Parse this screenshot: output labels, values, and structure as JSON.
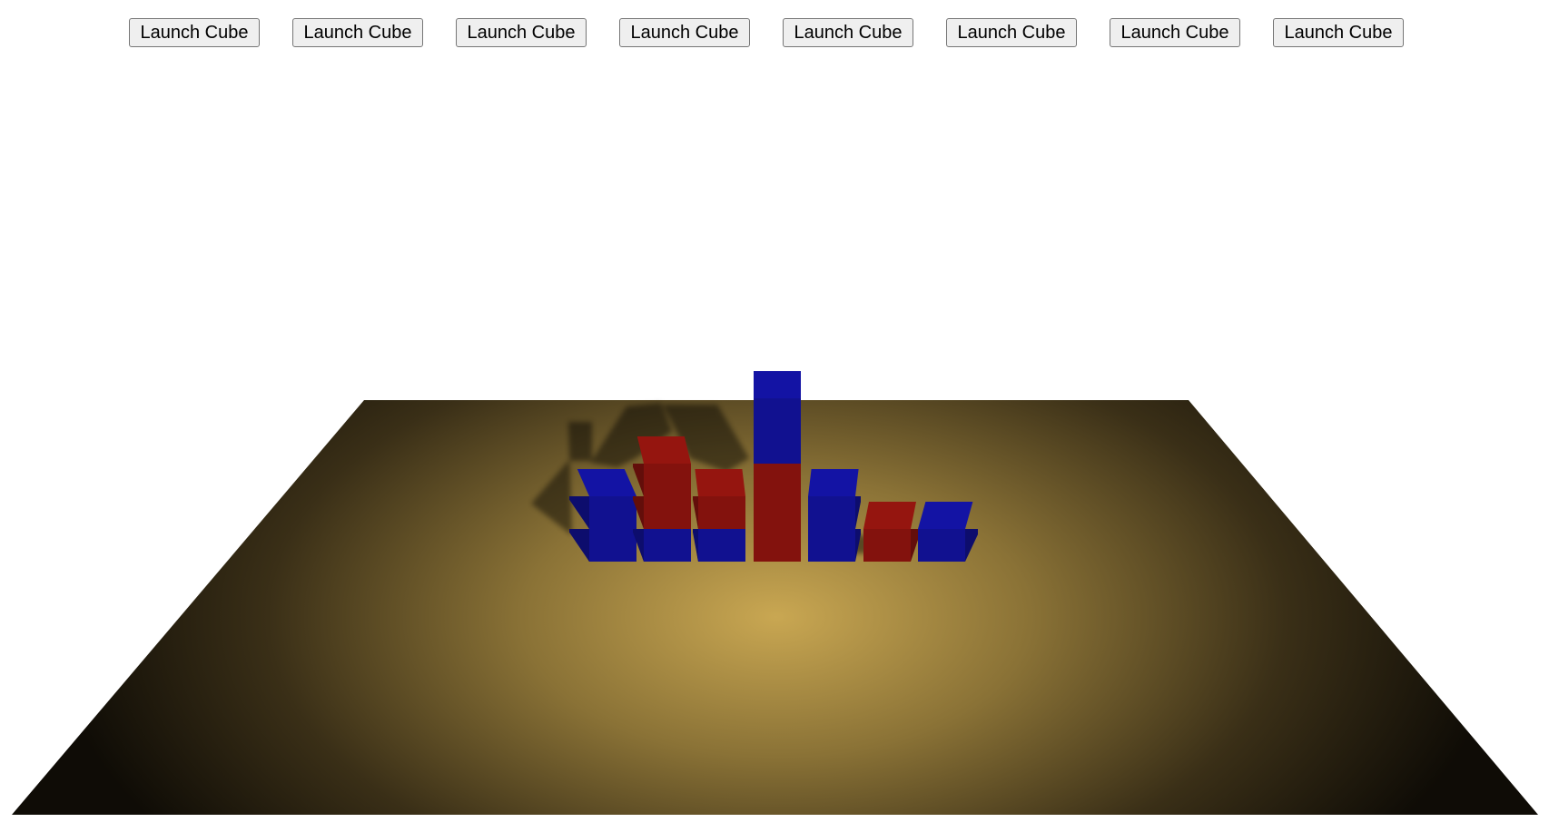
{
  "toolbar": {
    "buttons": [
      {
        "label": "Launch Cube"
      },
      {
        "label": "Launch Cube"
      },
      {
        "label": "Launch Cube"
      },
      {
        "label": "Launch Cube"
      },
      {
        "label": "Launch Cube"
      },
      {
        "label": "Launch Cube"
      },
      {
        "label": "Launch Cube"
      },
      {
        "label": "Launch Cube"
      }
    ]
  },
  "scene": {
    "floor_color_center": "#c9a752",
    "floor_color_edge": "#0f0c06",
    "cube_colors": {
      "red": "#8e140e",
      "blue": "#12129c"
    },
    "stacks": [
      {
        "cubes": [
          "blue",
          "blue"
        ]
      },
      {
        "cubes": [
          "blue",
          "red",
          "red"
        ]
      },
      {
        "cubes": [
          "blue",
          "red"
        ]
      },
      {
        "cubes": [
          "red",
          "red",
          "red",
          "blue",
          "blue"
        ]
      },
      {
        "cubes": [
          "blue",
          "blue"
        ]
      },
      {
        "cubes": [
          "red"
        ]
      },
      {
        "cubes": [
          "blue"
        ]
      }
    ]
  }
}
